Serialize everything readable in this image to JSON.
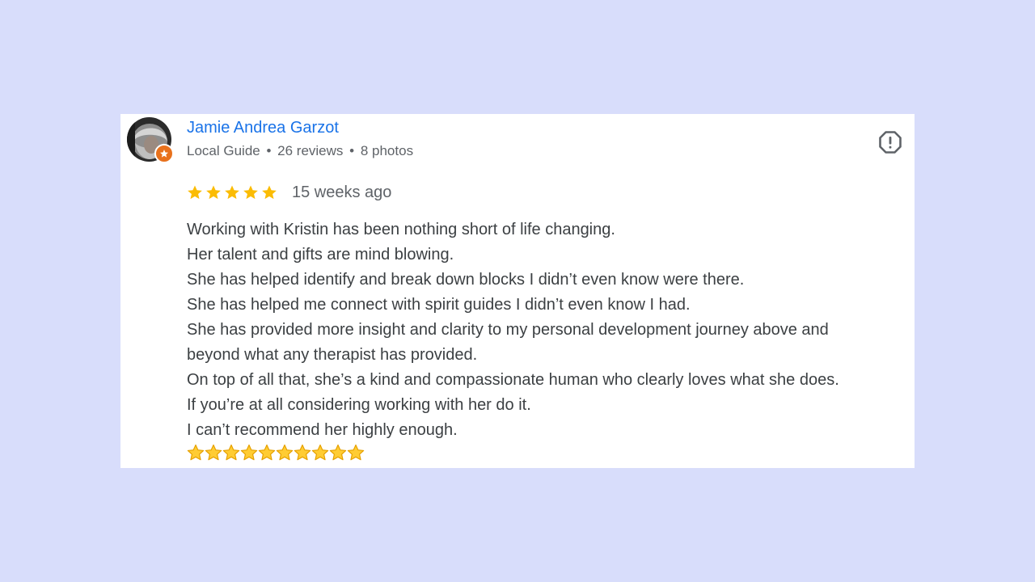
{
  "reviewer": {
    "name": "Jamie Andrea Garzot",
    "badge": "Local Guide",
    "reviews": "26 reviews",
    "photos": "8 photos",
    "separator": "•"
  },
  "rating": {
    "stars": 5,
    "max": 5,
    "date": "15 weeks ago"
  },
  "review": {
    "lines": [
      "Working with Kristin has been nothing short of life changing.",
      "Her talent and gifts are mind blowing.",
      "She has helped identify and break down blocks I didn’t even know were there.",
      "She has helped me connect with spirit guides I didn’t even know I had.",
      "She has provided more insight and clarity to my personal development journey above and",
      "beyond what any therapist has provided.",
      "On top of all that, she’s a kind and compassionate human who clearly loves what she does.",
      "If you’re at all considering working with her do it.",
      "I can’t recommend her highly enough."
    ],
    "emoji_star_count": 10
  },
  "icons": {
    "report": "report-flag-icon",
    "badge": "local-guide-star-icon",
    "rating_star": "star-icon",
    "emoji_star": "star-emoji-icon"
  },
  "colors": {
    "background": "#d8ddfb",
    "name": "#1a73e8",
    "star": "#fbbc04",
    "badge": "#e8711c",
    "text": "#3c4043",
    "meta": "#5f6368"
  }
}
